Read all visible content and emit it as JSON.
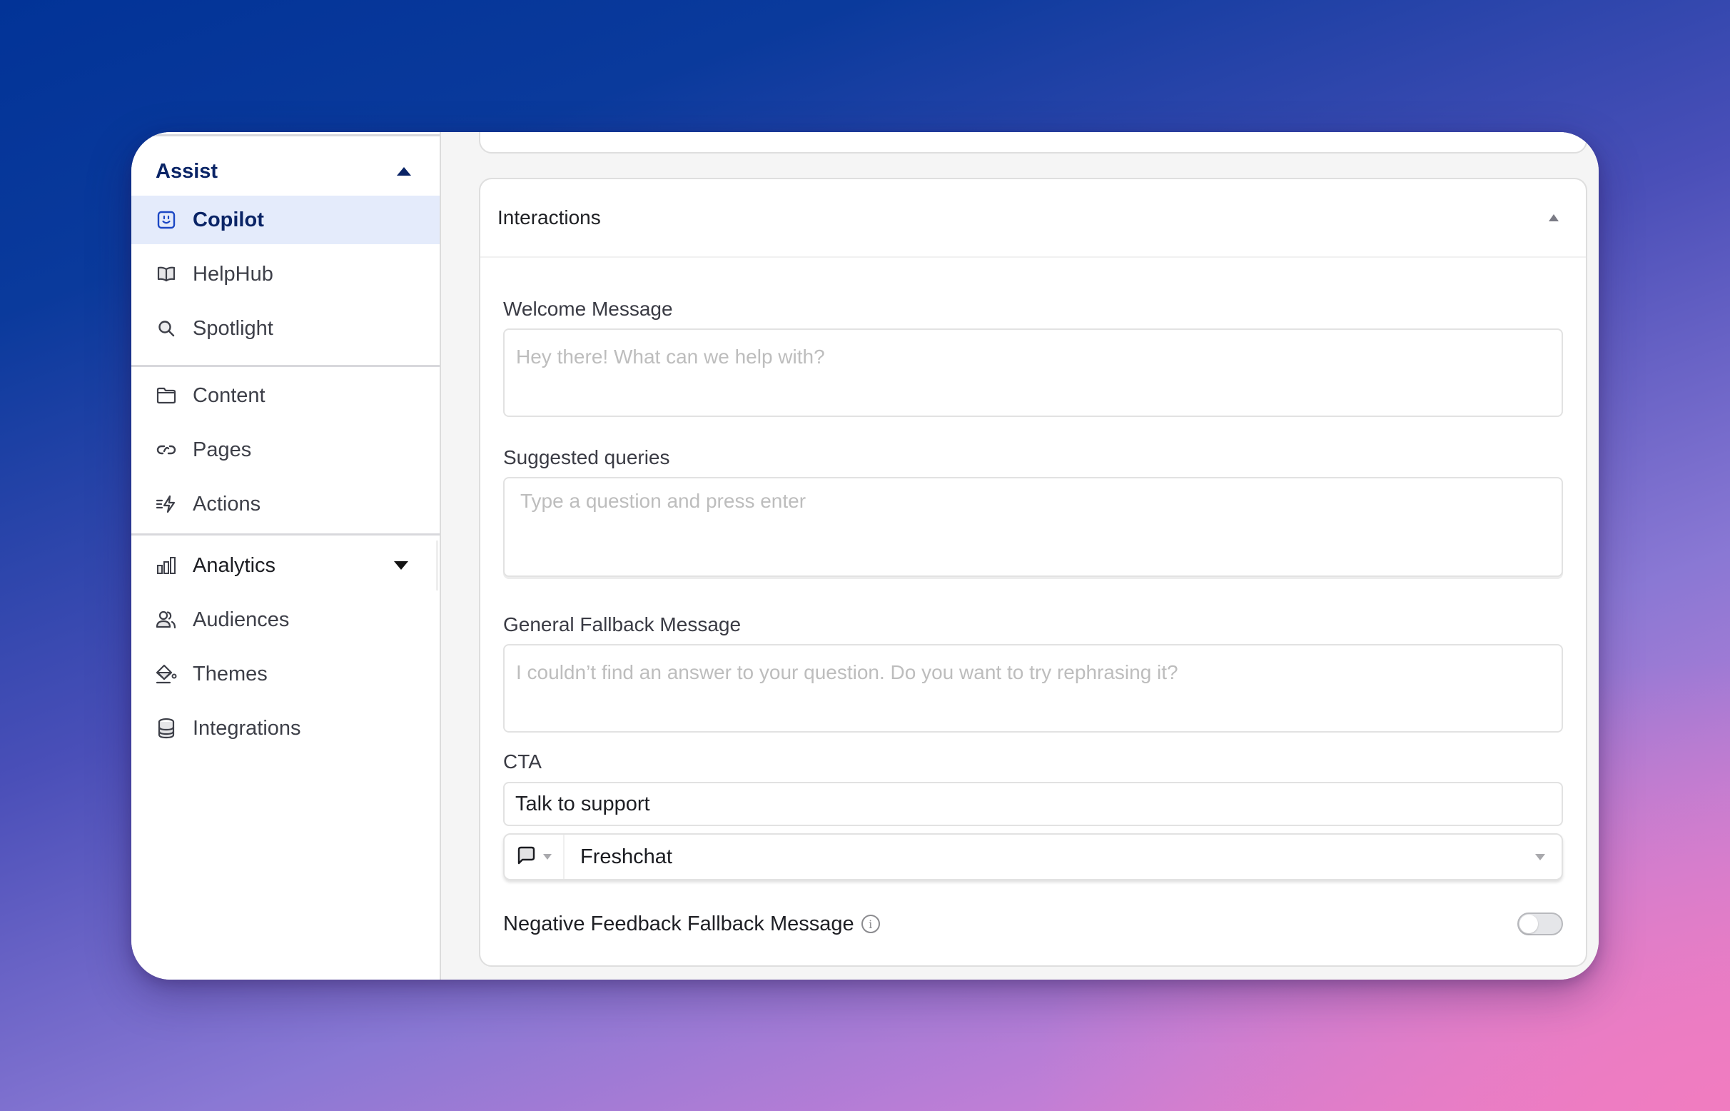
{
  "sidebar": {
    "group": {
      "label": "Assist",
      "expanded": true
    },
    "items": [
      {
        "label": "Copilot",
        "icon": "copilot-face-icon",
        "active": true
      },
      {
        "label": "HelpHub",
        "icon": "book-open-icon",
        "active": false
      },
      {
        "label": "Spotlight",
        "icon": "search-icon",
        "active": false
      },
      {
        "label": "Content",
        "icon": "folder-icon",
        "active": false
      },
      {
        "label": "Pages",
        "icon": "link-icon",
        "active": false
      },
      {
        "label": "Actions",
        "icon": "lightning-icon",
        "active": false
      },
      {
        "label": "Analytics",
        "icon": "bar-chart-icon",
        "active": false,
        "collapsible": true,
        "expanded": false
      },
      {
        "label": "Audiences",
        "icon": "users-icon",
        "active": false
      },
      {
        "label": "Themes",
        "icon": "paint-bucket-icon",
        "active": false
      },
      {
        "label": "Integrations",
        "icon": "database-icon",
        "active": false
      }
    ]
  },
  "section": {
    "title": "Interactions",
    "expanded": true,
    "fields": {
      "welcome": {
        "label": "Welcome Message",
        "placeholder": "Hey there! What can we help with?",
        "value": ""
      },
      "suggested": {
        "label": "Suggested queries",
        "placeholder": "Type a question and press enter",
        "value": ""
      },
      "fallback": {
        "label": "General Fallback Message",
        "placeholder": "I couldn’t find an answer to your question. Do you want to try rephrasing it?",
        "value": ""
      },
      "cta": {
        "label": "CTA",
        "value": "Talk to support",
        "action_icon": "chat-bubble-icon",
        "action_value": "Freshchat"
      },
      "negative_feedback": {
        "label": "Negative Feedback Fallback Message",
        "enabled": false
      }
    }
  },
  "colors": {
    "accent": "#0a2466",
    "active_bg": "#e4ebfb",
    "placeholder": "#bdbdbd"
  }
}
